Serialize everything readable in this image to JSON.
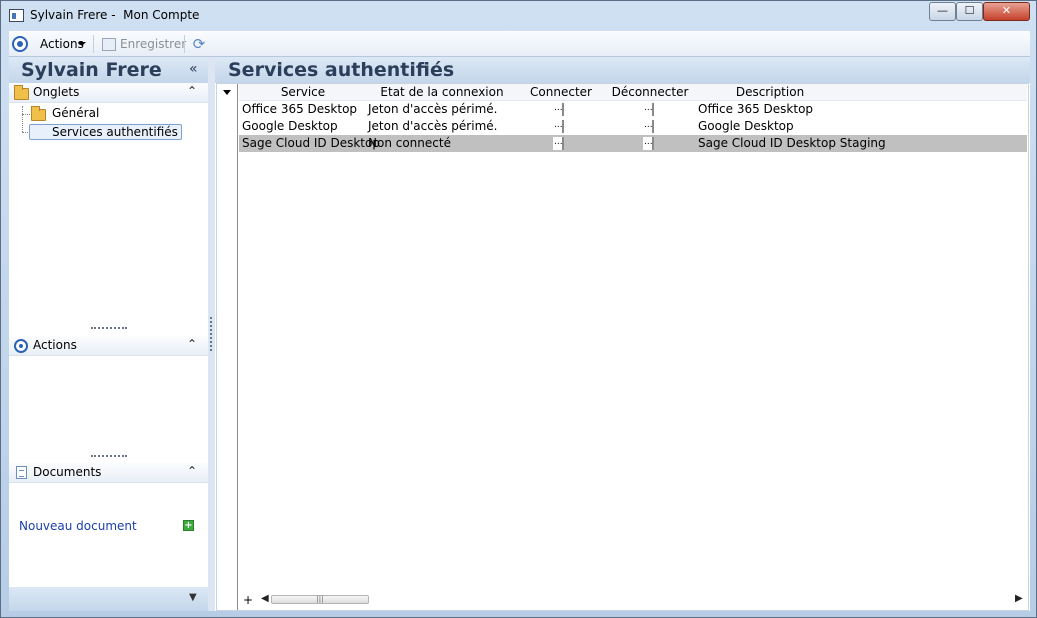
{
  "window": {
    "title": "Sylvain Frere -  Mon Compte",
    "minimize": "—",
    "maximize": "☐",
    "close": "✕"
  },
  "toolbar": {
    "actions_label": "Actions",
    "save_label": "Enregistrer"
  },
  "left": {
    "title": "Sylvain Frere",
    "collapse_glyph": "«",
    "sections": {
      "onglets": {
        "label": "Onglets",
        "chevron": "⌃"
      },
      "actions": {
        "label": "Actions",
        "chevron": "⌃"
      },
      "documents": {
        "label": "Documents",
        "chevron": "⌃"
      }
    },
    "tree": [
      {
        "label": "Général",
        "selected": false
      },
      {
        "label": "Services authentifiés",
        "selected": true
      }
    ],
    "new_document": "Nouveau document",
    "footer_caret": "▼"
  },
  "main": {
    "title": "Services authentifiés",
    "columns": [
      "Service",
      "Etat de la connexion",
      "Connecter",
      "Déconnecter",
      "Description"
    ],
    "rows": [
      {
        "service": "Office 365 Desktop",
        "state": "Jeton d'accès périmé.",
        "connect": "...",
        "disconnect": "...",
        "description": "Office 365 Desktop",
        "selected": false
      },
      {
        "service": "Google Desktop",
        "state": "Jeton d'accès périmé.",
        "connect": "...",
        "disconnect": "...",
        "description": "Google Desktop",
        "selected": false
      },
      {
        "service": "Sage Cloud ID Desktop",
        "state": "Non connecté",
        "connect": "...",
        "disconnect": "...",
        "description": "Sage Cloud ID Desktop Staging",
        "selected": true
      }
    ],
    "scroll_thumb_glyph": "|||"
  },
  "colors": {
    "header_text": "#2b3f5a",
    "link": "#1a3faa",
    "selected_row": "#c0c0c0"
  }
}
